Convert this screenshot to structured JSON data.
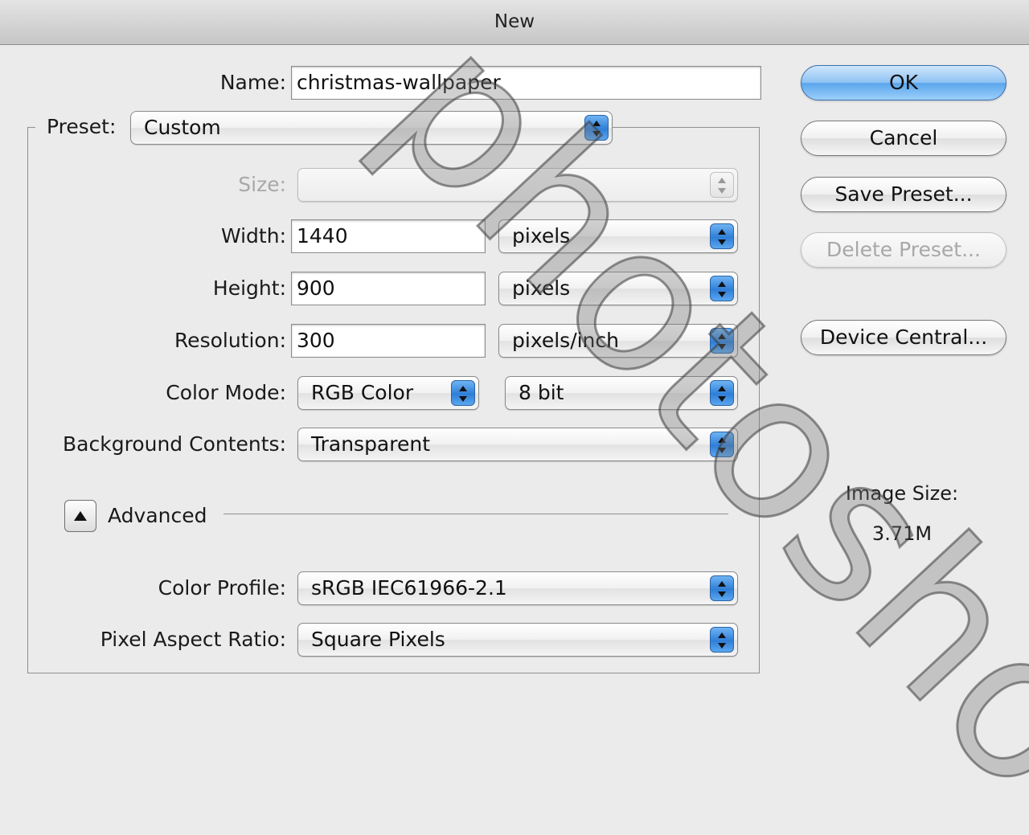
{
  "window": {
    "title": "New"
  },
  "form": {
    "name_label": "Name:",
    "name_value": "christmas-wallpaper",
    "preset_label": "Preset:",
    "preset_value": "Custom",
    "size_label": "Size:",
    "size_value": "",
    "width_label": "Width:",
    "width_value": "1440",
    "width_unit": "pixels",
    "height_label": "Height:",
    "height_value": "900",
    "height_unit": "pixels",
    "resolution_label": "Resolution:",
    "resolution_value": "300",
    "resolution_unit": "pixels/inch",
    "color_mode_label": "Color Mode:",
    "color_mode_value": "RGB Color",
    "bit_depth_value": "8 bit",
    "background_label": "Background Contents:",
    "background_value": "Transparent"
  },
  "advanced": {
    "label": "Advanced",
    "color_profile_label": "Color Profile:",
    "color_profile_value": "sRGB IEC61966-2.1",
    "pixel_aspect_label": "Pixel Aspect Ratio:",
    "pixel_aspect_value": "Square Pixels"
  },
  "buttons": {
    "ok": "OK",
    "cancel": "Cancel",
    "save_preset": "Save Preset...",
    "delete_preset": "Delete Preset...",
    "device_central": "Device Central..."
  },
  "image_size": {
    "label": "Image Size:",
    "value": "3.71M"
  },
  "watermark": "photosho",
  "icons": {
    "popup_arrows": "updown-arrows-icon",
    "disclosure": "triangle-up-icon"
  },
  "colors": {
    "accent": "#3a86dc",
    "default_button": "#7fbcf1"
  }
}
